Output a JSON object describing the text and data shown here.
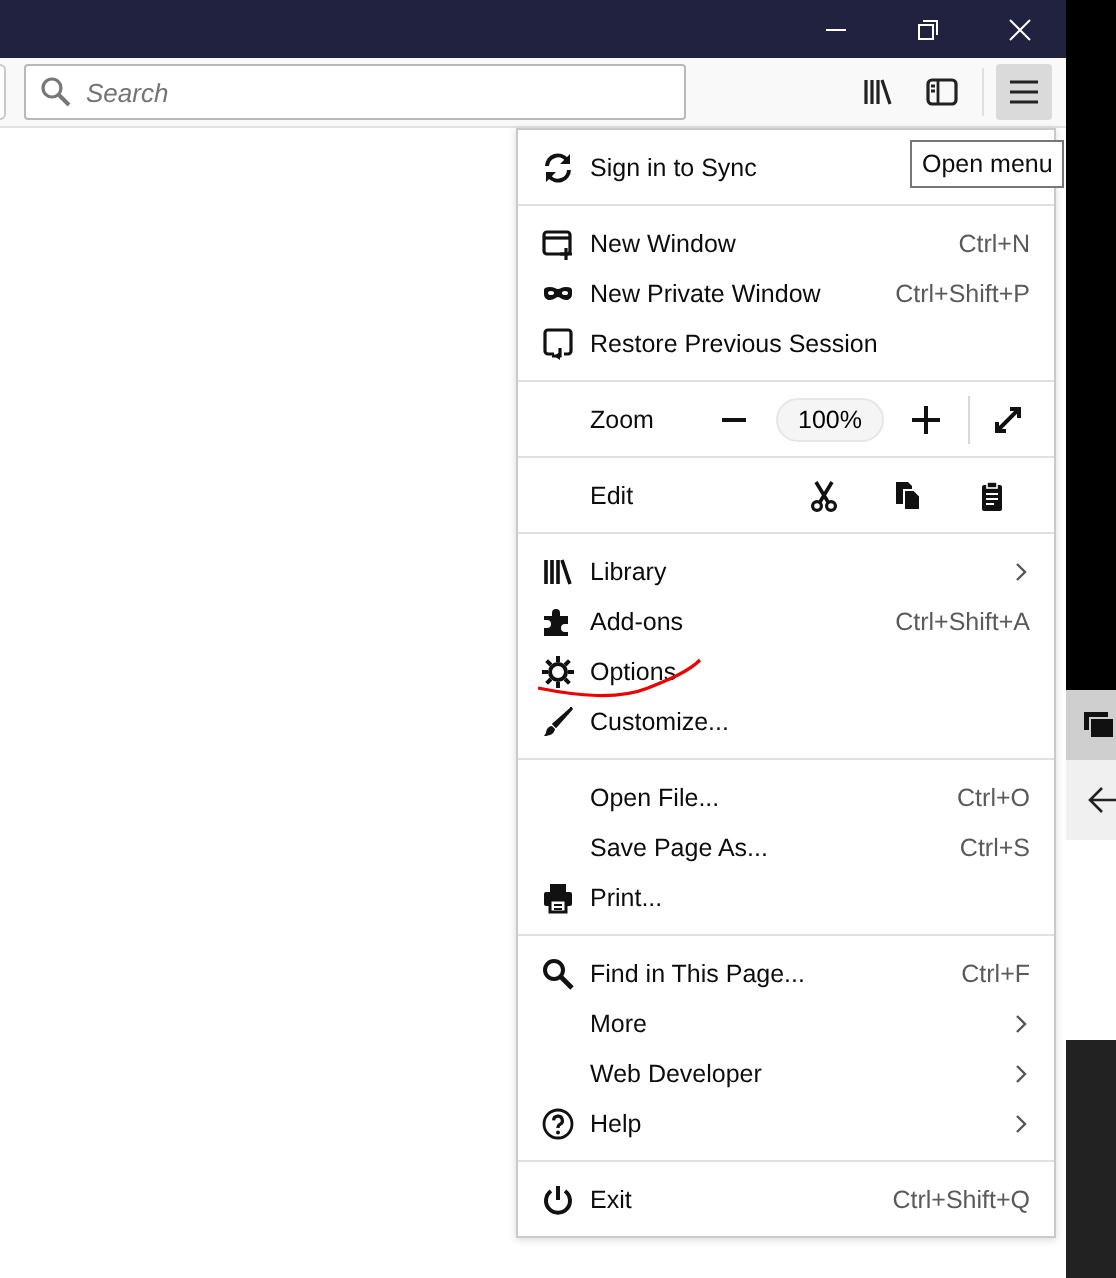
{
  "toolbar": {
    "search": {
      "placeholder": "Search"
    },
    "menu_button": {
      "selected": true
    }
  },
  "tooltip": "Open menu",
  "menu": {
    "sections": [
      [
        {
          "kind": "item",
          "label": "Sign in to Sync"
        }
      ],
      [
        {
          "kind": "item",
          "label": "New Window",
          "shortcut": "Ctrl+N"
        },
        {
          "kind": "item",
          "label": "New Private Window",
          "shortcut": "Ctrl+Shift+P"
        },
        {
          "kind": "item",
          "label": "Restore Previous Session"
        }
      ],
      [
        {
          "kind": "zoom",
          "label": "Zoom",
          "value": "100%"
        }
      ],
      [
        {
          "kind": "edit",
          "label": "Edit"
        }
      ],
      [
        {
          "kind": "item",
          "label": "Library",
          "submenu": true
        },
        {
          "kind": "item",
          "label": "Add-ons",
          "shortcut": "Ctrl+Shift+A"
        },
        {
          "kind": "item",
          "label": "Options"
        },
        {
          "kind": "item",
          "label": "Customize..."
        }
      ],
      [
        {
          "kind": "item",
          "label": "Open File...",
          "shortcut": "Ctrl+O"
        },
        {
          "kind": "item",
          "label": "Save Page As...",
          "shortcut": "Ctrl+S"
        },
        {
          "kind": "item",
          "label": "Print..."
        }
      ],
      [
        {
          "kind": "item",
          "label": "Find in This Page...",
          "shortcut": "Ctrl+F"
        },
        {
          "kind": "item",
          "label": "More",
          "submenu": true
        },
        {
          "kind": "item",
          "label": "Web Developer",
          "submenu": true
        },
        {
          "kind": "item",
          "label": "Help",
          "submenu": true
        }
      ],
      [
        {
          "kind": "item",
          "label": "Exit",
          "shortcut": "Ctrl+Shift+Q"
        }
      ]
    ]
  }
}
